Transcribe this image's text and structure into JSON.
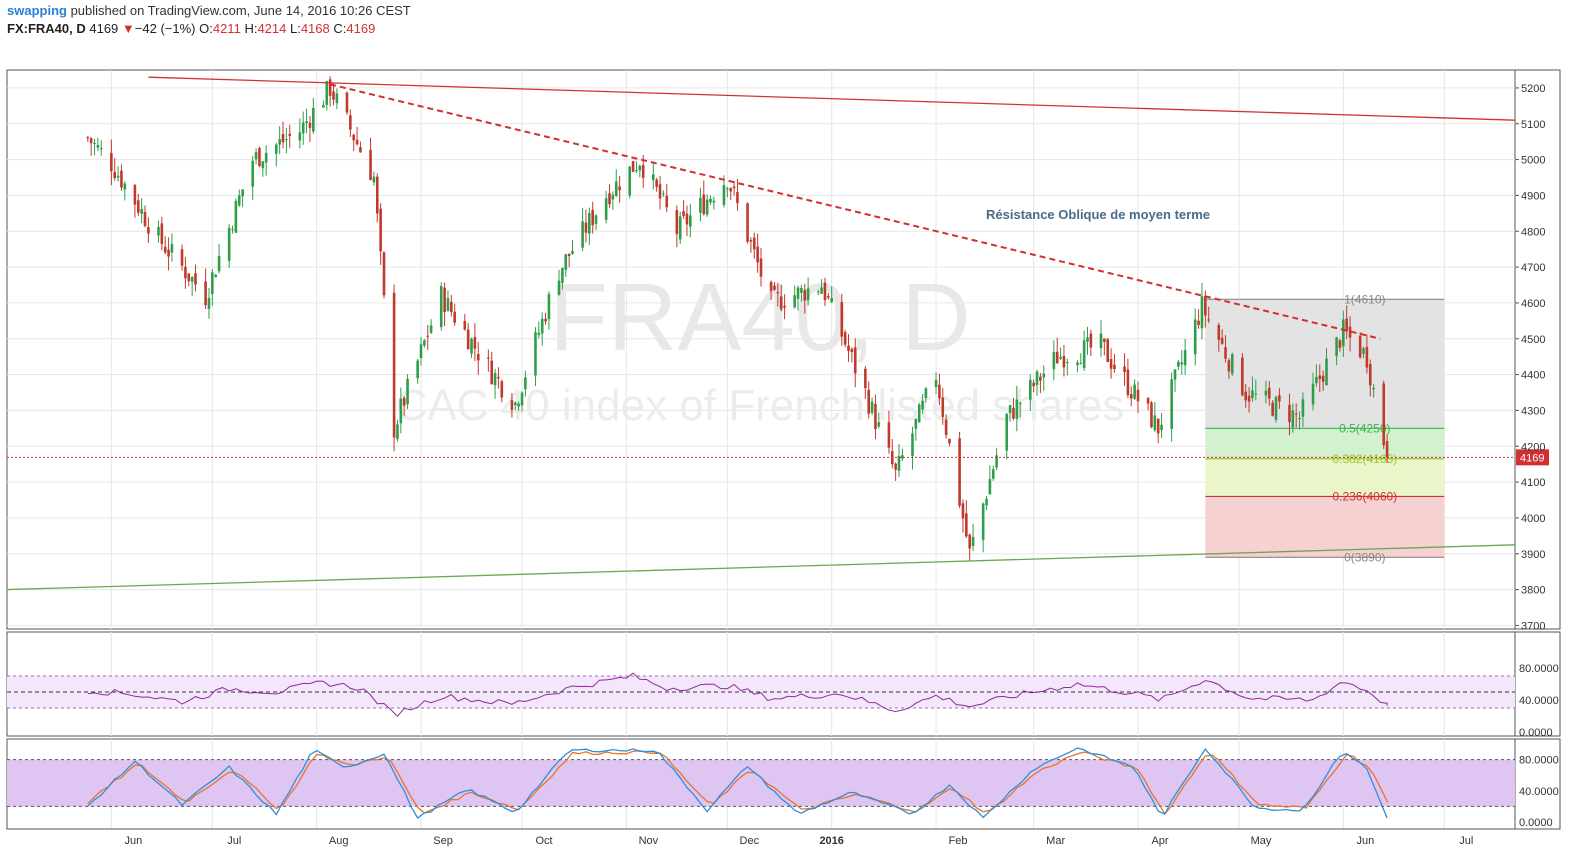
{
  "header": {
    "user": "swapping",
    "published": "published on TradingView.com, June 14, 2016 10:26 CEST",
    "symbol": "FX:FRA40, D",
    "last": "4169",
    "change_arrow": "▼",
    "change": "−42 (−1%)",
    "o_label": "O:",
    "o": "4211",
    "h_label": "H:",
    "h": "4214",
    "l_label": "L:",
    "l": "4168",
    "c_label": "C:",
    "c": "4169"
  },
  "watermark": {
    "symbol": "FRA40, D",
    "description": "CAC 40 index of French listed shares"
  },
  "annotation": "Résistance Oblique de moyen terme",
  "colors": {
    "up": "#2e9e4a",
    "down": "#c0392b",
    "resistance": "#d23030",
    "support": "#6aa84f",
    "rsi": "#8e2a9a",
    "stoch_k": "#2f8fd8",
    "stoch_d": "#e8732c",
    "band": "#dfc6f2"
  },
  "chart_data": [
    {
      "type": "candlestick",
      "series_name": "FX:FRA40, D",
      "x_ticks": [
        "Jun",
        "Jul",
        "Aug",
        "Sep",
        "Oct",
        "Nov",
        "Dec",
        "2016",
        "Feb",
        "Mar",
        "Apr",
        "May",
        "Jun",
        "Jul"
      ],
      "y_ticks": [
        3700,
        3800,
        3900,
        4000,
        4100,
        4200,
        4300,
        4400,
        4500,
        4600,
        4700,
        4800,
        4900,
        5000,
        5100,
        5200
      ],
      "ylim": [
        3690,
        5250
      ],
      "last_price": 4169,
      "path": [
        [
          "2015-05-25",
          5060
        ],
        [
          "2015-06-01",
          4990
        ],
        [
          "2015-06-15",
          4780
        ],
        [
          "2015-06-29",
          4620
        ],
        [
          "2015-07-13",
          5000
        ],
        [
          "2015-07-27",
          5080
        ],
        [
          "2015-08-05",
          5200
        ],
        [
          "2015-08-18",
          4950
        ],
        [
          "2015-08-24",
          4250
        ],
        [
          "2015-09-07",
          4620
        ],
        [
          "2015-09-21",
          4420
        ],
        [
          "2015-09-29",
          4320
        ],
        [
          "2015-10-12",
          4690
        ],
        [
          "2015-10-26",
          4900
        ],
        [
          "2015-11-05",
          5000
        ],
        [
          "2015-11-16",
          4800
        ],
        [
          "2015-12-01",
          4950
        ],
        [
          "2015-12-14",
          4600
        ],
        [
          "2015-12-29",
          4650
        ],
        [
          "2016-01-11",
          4350
        ],
        [
          "2016-01-20",
          4120
        ],
        [
          "2016-02-01",
          4400
        ],
        [
          "2016-02-11",
          3900
        ],
        [
          "2016-02-22",
          4280
        ],
        [
          "2016-03-08",
          4450
        ],
        [
          "2016-03-21",
          4480
        ],
        [
          "2016-04-07",
          4250
        ],
        [
          "2016-04-20",
          4590
        ],
        [
          "2016-05-03",
          4350
        ],
        [
          "2016-05-19",
          4280
        ],
        [
          "2016-06-01",
          4520
        ],
        [
          "2016-06-08",
          4450
        ],
        [
          "2016-06-14",
          4169
        ]
      ],
      "trendlines": [
        {
          "from": [
            "2015-06-12",
            5230
          ],
          "to": [
            "2016-07-22",
            5110
          ],
          "style": "solid",
          "color": "red"
        },
        {
          "from": [
            "2015-08-05",
            5210
          ],
          "to": [
            "2016-06-12",
            4500
          ],
          "style": "dashed",
          "color": "red",
          "label": "Résistance Oblique de moyen terme"
        },
        {
          "from": [
            "2015-05-01",
            3800
          ],
          "to": [
            "2016-07-22",
            3925
          ],
          "style": "solid",
          "color": "green"
        }
      ],
      "fibonacci": {
        "from_date": "2016-04-21",
        "to_date": "2016-07-01",
        "levels": [
          {
            "label": "1(4610)",
            "value": 4610
          },
          {
            "label": "0.5(4250)",
            "value": 4250
          },
          {
            "label": "0.382(4165)",
            "value": 4165
          },
          {
            "label": "0.236(4060)",
            "value": 4060
          },
          {
            "label": "0(3890)",
            "value": 3890
          }
        ]
      }
    },
    {
      "type": "line",
      "series_name": "RSI",
      "y_ticks": [
        "80.0000",
        "40.0000",
        "0.0000"
      ],
      "ylim": [
        0,
        100
      ],
      "band": [
        30,
        70
      ],
      "midline": 50,
      "path": [
        [
          "2015-05-25",
          52
        ],
        [
          "2015-06-08",
          47
        ],
        [
          "2015-06-22",
          38
        ],
        [
          "2015-07-06",
          54
        ],
        [
          "2015-07-20",
          50
        ],
        [
          "2015-08-03",
          62
        ],
        [
          "2015-08-14",
          55
        ],
        [
          "2015-08-24",
          22
        ],
        [
          "2015-09-07",
          45
        ],
        [
          "2015-09-28",
          35
        ],
        [
          "2015-10-15",
          55
        ],
        [
          "2015-11-03",
          70
        ],
        [
          "2015-11-13",
          55
        ],
        [
          "2015-12-01",
          58
        ],
        [
          "2015-12-14",
          42
        ],
        [
          "2016-01-04",
          48
        ],
        [
          "2016-01-20",
          27
        ],
        [
          "2016-02-01",
          45
        ],
        [
          "2016-02-11",
          32
        ],
        [
          "2016-02-25",
          46
        ],
        [
          "2016-03-14",
          60
        ],
        [
          "2016-03-31",
          48
        ],
        [
          "2016-04-08",
          40
        ],
        [
          "2016-04-21",
          66
        ],
        [
          "2016-05-04",
          42
        ],
        [
          "2016-05-23",
          40
        ],
        [
          "2016-06-01",
          64
        ],
        [
          "2016-06-09",
          50
        ],
        [
          "2016-06-14",
          33
        ]
      ]
    },
    {
      "type": "line",
      "series_name": "Stochastic",
      "y_ticks": [
        "80.0000",
        "40.0000",
        "0.0000"
      ],
      "ylim": [
        0,
        100
      ],
      "band": [
        20,
        80
      ],
      "series": [
        {
          "values_path": [
            [
              "2015-05-25",
              20
            ],
            [
              "2015-06-08",
              78
            ],
            [
              "2015-06-22",
              22
            ],
            [
              "2015-07-06",
              70
            ],
            [
              "2015-07-20",
              10
            ],
            [
              "2015-07-31",
              92
            ],
            [
              "2015-08-10",
              70
            ],
            [
              "2015-08-21",
              88
            ],
            [
              "2015-08-31",
              5
            ],
            [
              "2015-09-15",
              42
            ],
            [
              "2015-09-29",
              12
            ],
            [
              "2015-10-15",
              92
            ],
            [
              "2015-11-10",
              92
            ],
            [
              "2015-11-25",
              15
            ],
            [
              "2015-12-07",
              72
            ],
            [
              "2015-12-22",
              10
            ],
            [
              "2016-01-07",
              38
            ],
            [
              "2016-01-25",
              10
            ],
            [
              "2016-02-05",
              48
            ],
            [
              "2016-02-15",
              5
            ],
            [
              "2016-03-01",
              68
            ],
            [
              "2016-03-14",
              95
            ],
            [
              "2016-03-31",
              70
            ],
            [
              "2016-04-08",
              5
            ],
            [
              "2016-04-21",
              95
            ],
            [
              "2016-05-06",
              18
            ],
            [
              "2016-05-20",
              15
            ],
            [
              "2016-06-01",
              92
            ],
            [
              "2016-06-08",
              68
            ],
            [
              "2016-06-14",
              5
            ]
          ]
        },
        {
          "values_path": [
            [
              "2015-05-25",
              25
            ],
            [
              "2015-06-09",
              75
            ],
            [
              "2015-06-23",
              25
            ],
            [
              "2015-07-07",
              68
            ],
            [
              "2015-07-21",
              15
            ],
            [
              "2015-08-01",
              88
            ],
            [
              "2015-08-11",
              72
            ],
            [
              "2015-08-22",
              85
            ],
            [
              "2015-09-01",
              10
            ],
            [
              "2015-09-16",
              38
            ],
            [
              "2015-09-30",
              16
            ],
            [
              "2015-10-16",
              88
            ],
            [
              "2015-11-11",
              90
            ],
            [
              "2015-11-26",
              20
            ],
            [
              "2015-12-08",
              68
            ],
            [
              "2015-12-23",
              15
            ],
            [
              "2016-01-08",
              35
            ],
            [
              "2016-01-26",
              14
            ],
            [
              "2016-02-06",
              44
            ],
            [
              "2016-02-16",
              10
            ],
            [
              "2016-03-02",
              64
            ],
            [
              "2016-03-15",
              90
            ],
            [
              "2016-04-01",
              68
            ],
            [
              "2016-04-09",
              10
            ],
            [
              "2016-04-22",
              92
            ],
            [
              "2016-05-07",
              22
            ],
            [
              "2016-05-21",
              18
            ],
            [
              "2016-06-02",
              88
            ],
            [
              "2016-06-09",
              70
            ],
            [
              "2016-06-14",
              25
            ]
          ]
        }
      ]
    }
  ]
}
